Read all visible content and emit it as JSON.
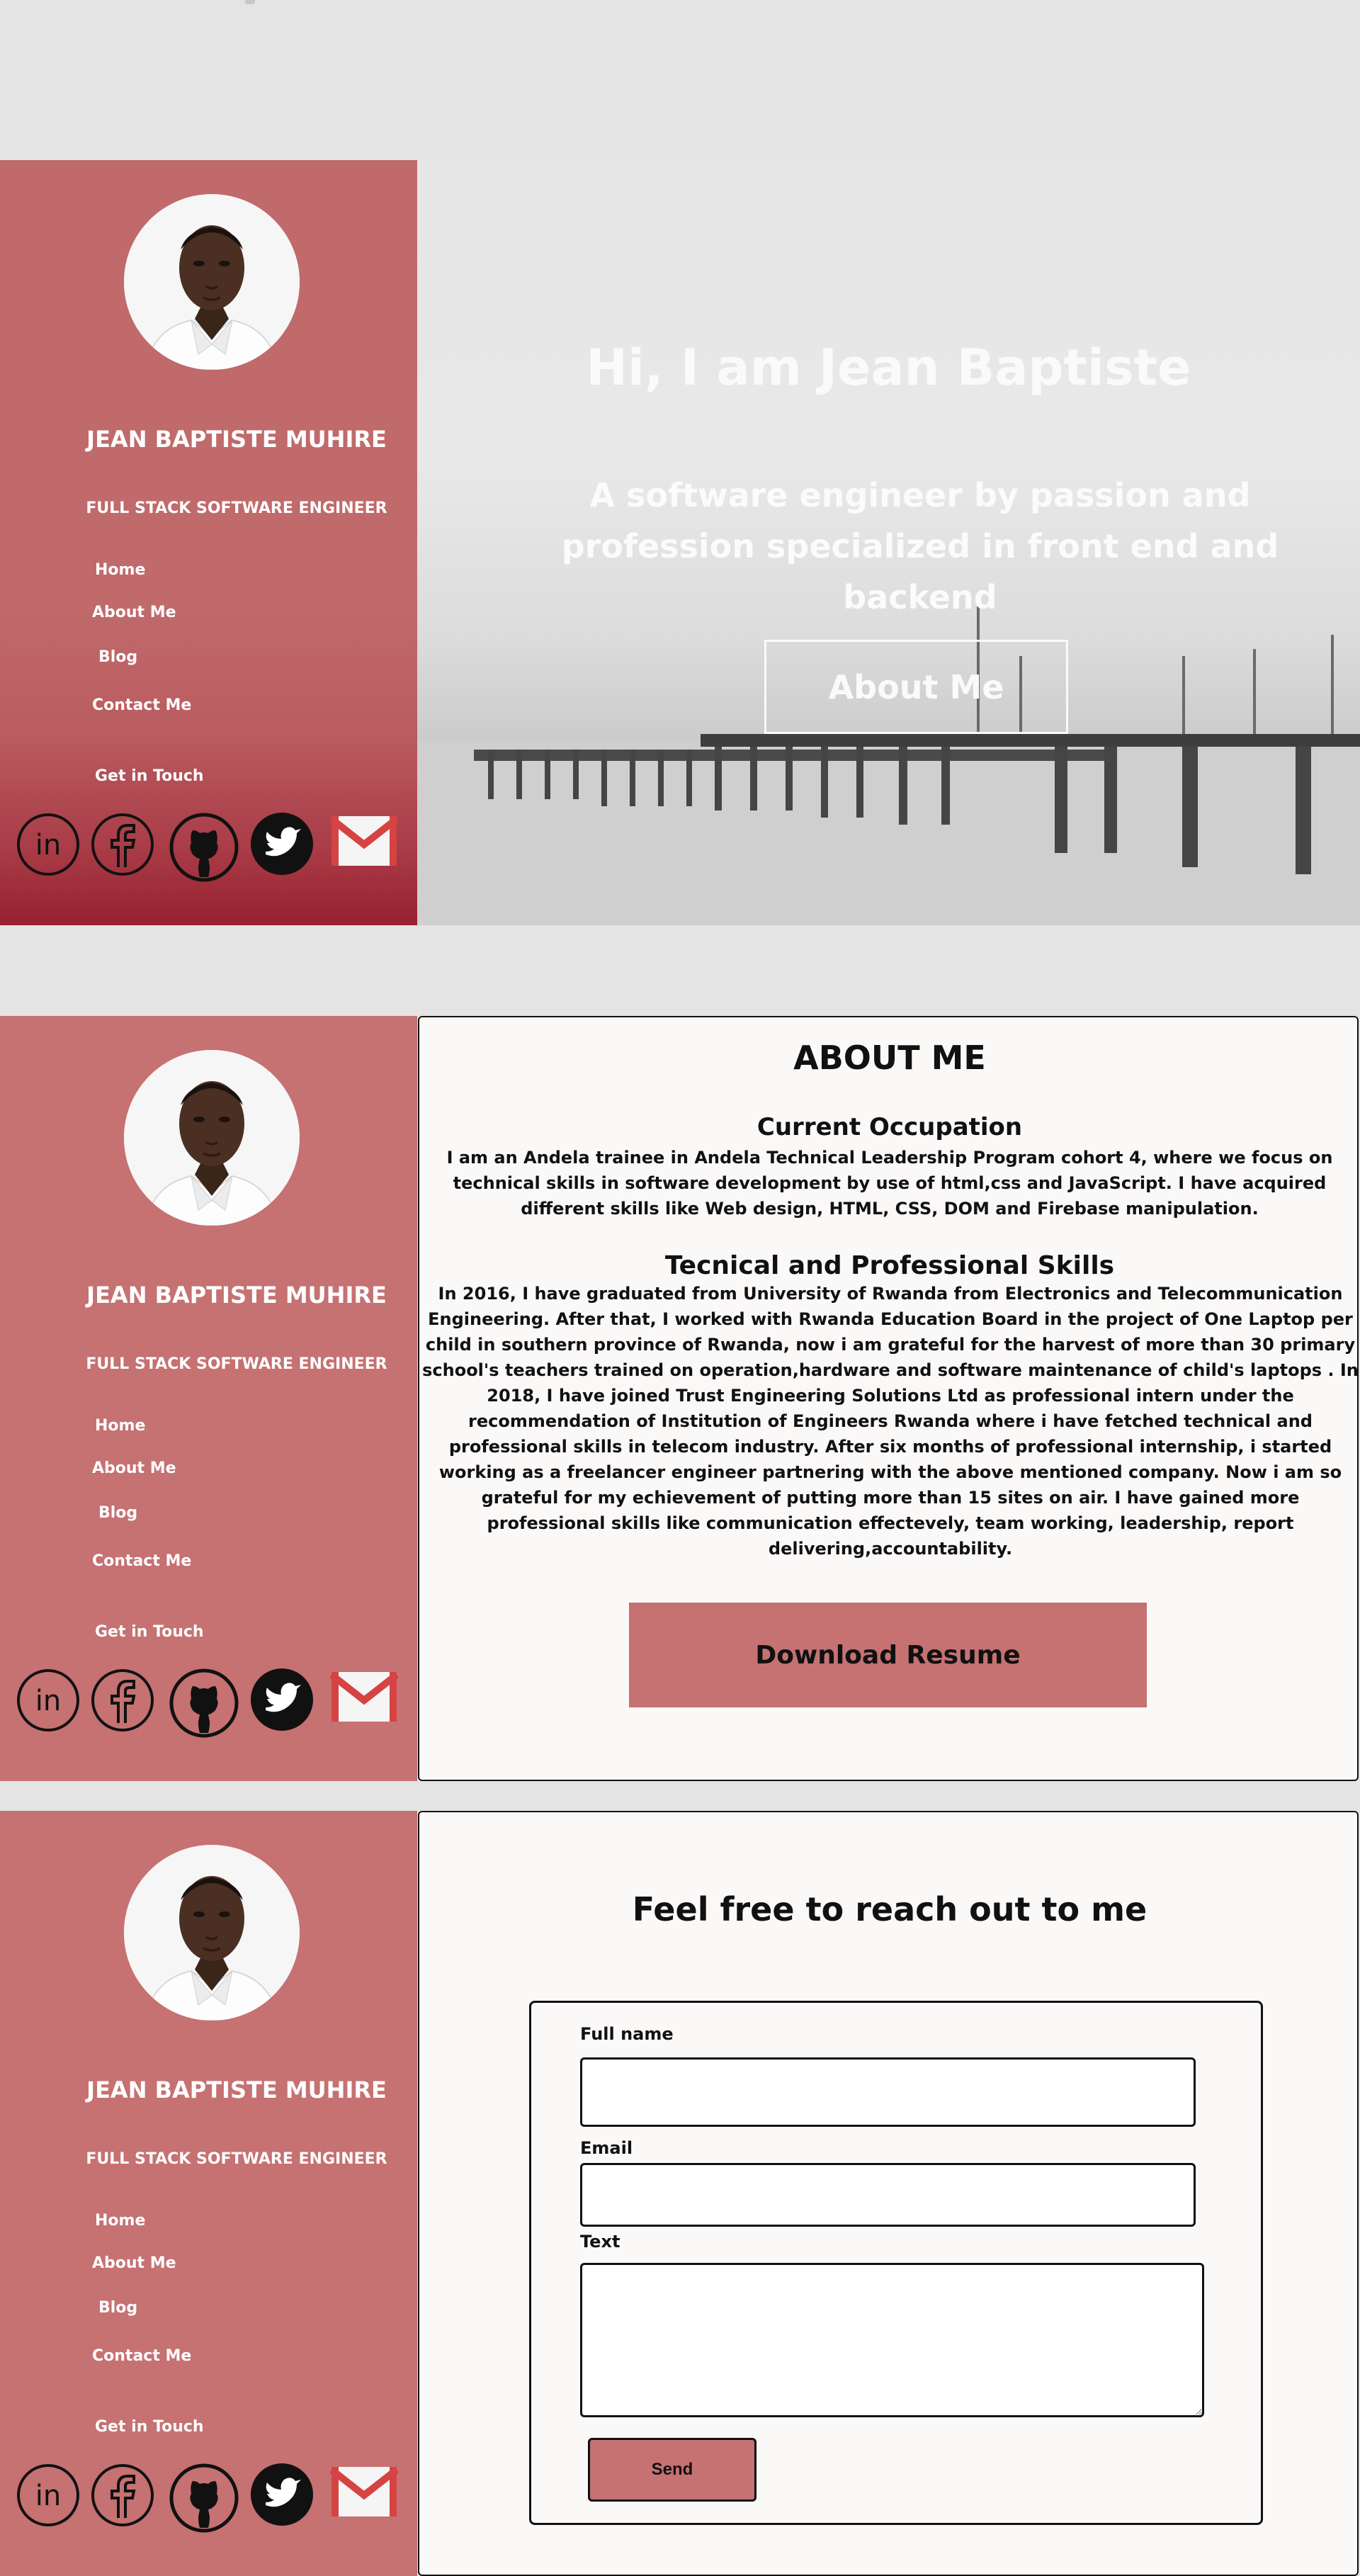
{
  "profile": {
    "name": "JEAN BAPTISTE MUHIRE",
    "role": "FULL STACK SOFTWARE ENGINEER"
  },
  "nav": {
    "home": "Home",
    "about": "About Me",
    "blog": "Blog",
    "contact": "Contact Me"
  },
  "social": {
    "heading": "Get in Touch",
    "icons": [
      "linkedin-icon",
      "facebook-icon",
      "github-icon",
      "twitter-icon",
      "gmail-icon"
    ]
  },
  "hero": {
    "title": "Hi, I am Jean Baptiste",
    "subtitle": "A software engineer by passion and profession specialized in front end and backend",
    "button": "About Me"
  },
  "about": {
    "heading": "ABOUT ME",
    "occupation_heading": "Current Occupation",
    "occupation_text": "I am an Andela trainee in Andela Technical Leadership Program cohort 4, where we focus on technical skills in software development by use of html,css and JavaScript. I have acquired different skills like Web design, HTML, CSS, DOM and Firebase manipulation.",
    "skills_heading": "Tecnical and Professional Skills",
    "skills_text": "In 2016, I have graduated from University of Rwanda from Electronics and Telecommunication Engineering. After that, I worked with Rwanda Education Board in the project of One Laptop per child in southern province of Rwanda, now i am grateful for the harvest of more than 30 primary school's teachers trained on operation,hardware and software maintenance of child's laptops . In 2018, I have joined Trust Engineering Solutions Ltd as professional intern under the recommendation of Institution of Engineers Rwanda where i have fetched technical and professional skills in telecom industry. After six months of professional internship, i started working as a freelancer engineer partnering with the above mentioned company. Now i am so grateful for my echievement of putting more than 15 sites on air. I have gained more professional skills like communication effectevely, team working, leadership, report delivering,accountability.",
    "download_button": "Download Resume"
  },
  "contact": {
    "heading": "Feel free to reach out to me",
    "fullname_label": "Full name",
    "email_label": "Email",
    "text_label": "Text",
    "send_button": "Send"
  },
  "colors": {
    "sidebar": "#c67172",
    "button": "#c67172",
    "page_bg": "#e4e4e4",
    "panel_bg": "#fbf8f8"
  }
}
